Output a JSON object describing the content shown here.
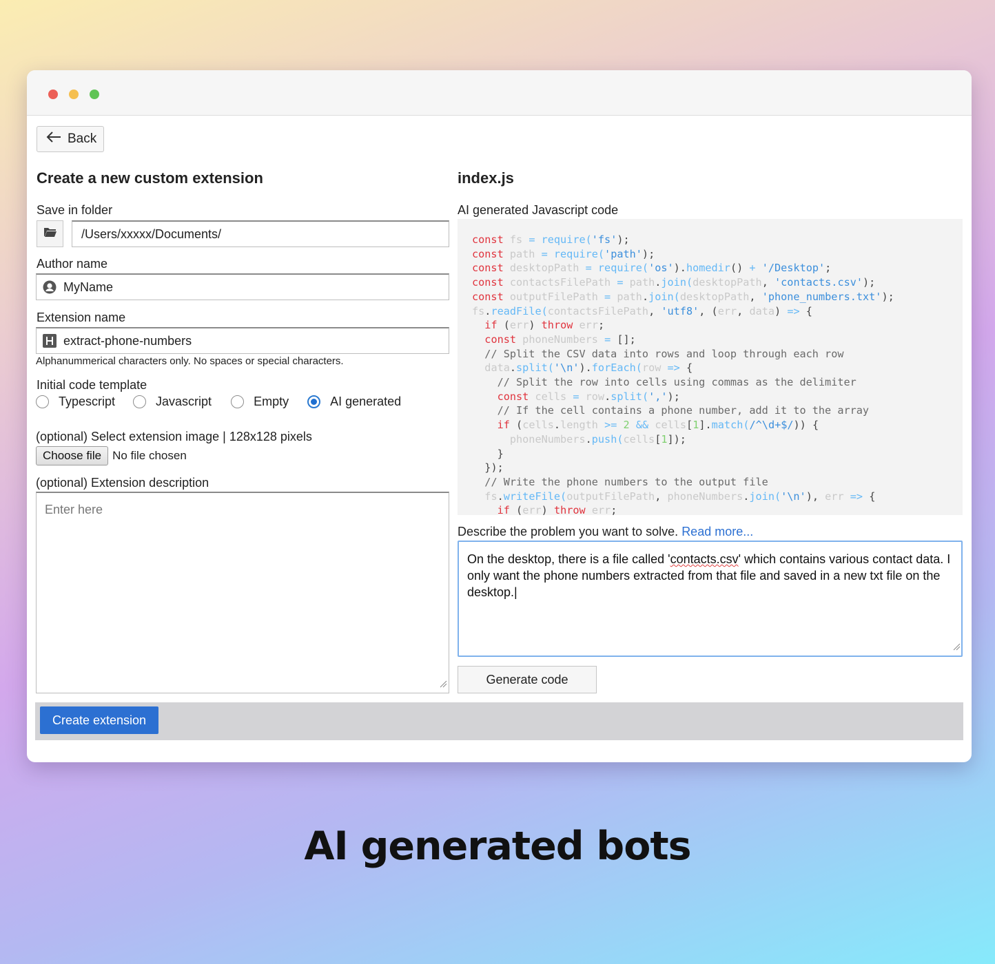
{
  "form": {
    "back_label": "Back",
    "heading": "Create a new custom extension",
    "save_folder_label": "Save in folder",
    "save_folder_value": "/Users/xxxxx/Documents/",
    "author_label": "Author name",
    "author_value": "MyName",
    "extension_name_label": "Extension name",
    "extension_name_value": "extract-phone-numbers",
    "extension_name_hint": "Alphanummerical characters only. No spaces or special characters.",
    "template_label": "Initial code template",
    "template_options": [
      "Typescript",
      "Javascript",
      "Empty",
      "AI generated"
    ],
    "template_selected": "AI generated",
    "image_label": "(optional) Select extension image | 128x128 pixels",
    "choose_file_label": "Choose file",
    "no_file_text": "No file chosen",
    "description_label": "(optional) Extension description",
    "description_placeholder": "Enter here",
    "create_label": "Create extension"
  },
  "code_panel": {
    "filename": "index.js",
    "subtitle": "AI generated Javascript code",
    "code": "const fs = require('fs');\nconst path = require('path');\nconst desktopPath = require('os').homedir() + '/Desktop';\nconst contactsFilePath = path.join(desktopPath, 'contacts.csv');\nconst outputFilePath = path.join(desktopPath, 'phone_numbers.txt');\nfs.readFile(contactsFilePath, 'utf8', (err, data) => {\n  if (err) throw err;\n  const phoneNumbers = [];\n  // Split the CSV data into rows and loop through each row\n  data.split('\\n').forEach(row => {\n    // Split the row into cells using commas as the delimiter\n    const cells = row.split(',');\n    // If the cell contains a phone number, add it to the array\n    if (cells.length >= 2 && cells[1].match(/^\\d+$/)) {\n      phoneNumbers.push(cells[1]);\n    }\n  });\n  // Write the phone numbers to the output file\n  fs.writeFile(outputFilePath, phoneNumbers.join('\\n'), err => {\n    if (err) throw err;",
    "describe_label": "Describe the problem you want to solve.",
    "read_more_label": "Read more...",
    "prompt_value": "On the desktop, there is a file called 'contacts.csv' which contains various contact data. I only want the phone numbers extracted from that file and saved in a new txt file on the desktop.",
    "generate_label": "Generate code"
  },
  "caption": "AI generated bots",
  "colors": {
    "accent": "#2c70d2",
    "keyword": "#e0343e",
    "string": "#3c8fdc"
  },
  "icons": {
    "back": "arrow-left-icon",
    "folder": "folder-icon",
    "author": "user-icon",
    "extension_name": "heading-icon",
    "resize": "resize-handle-icon"
  }
}
